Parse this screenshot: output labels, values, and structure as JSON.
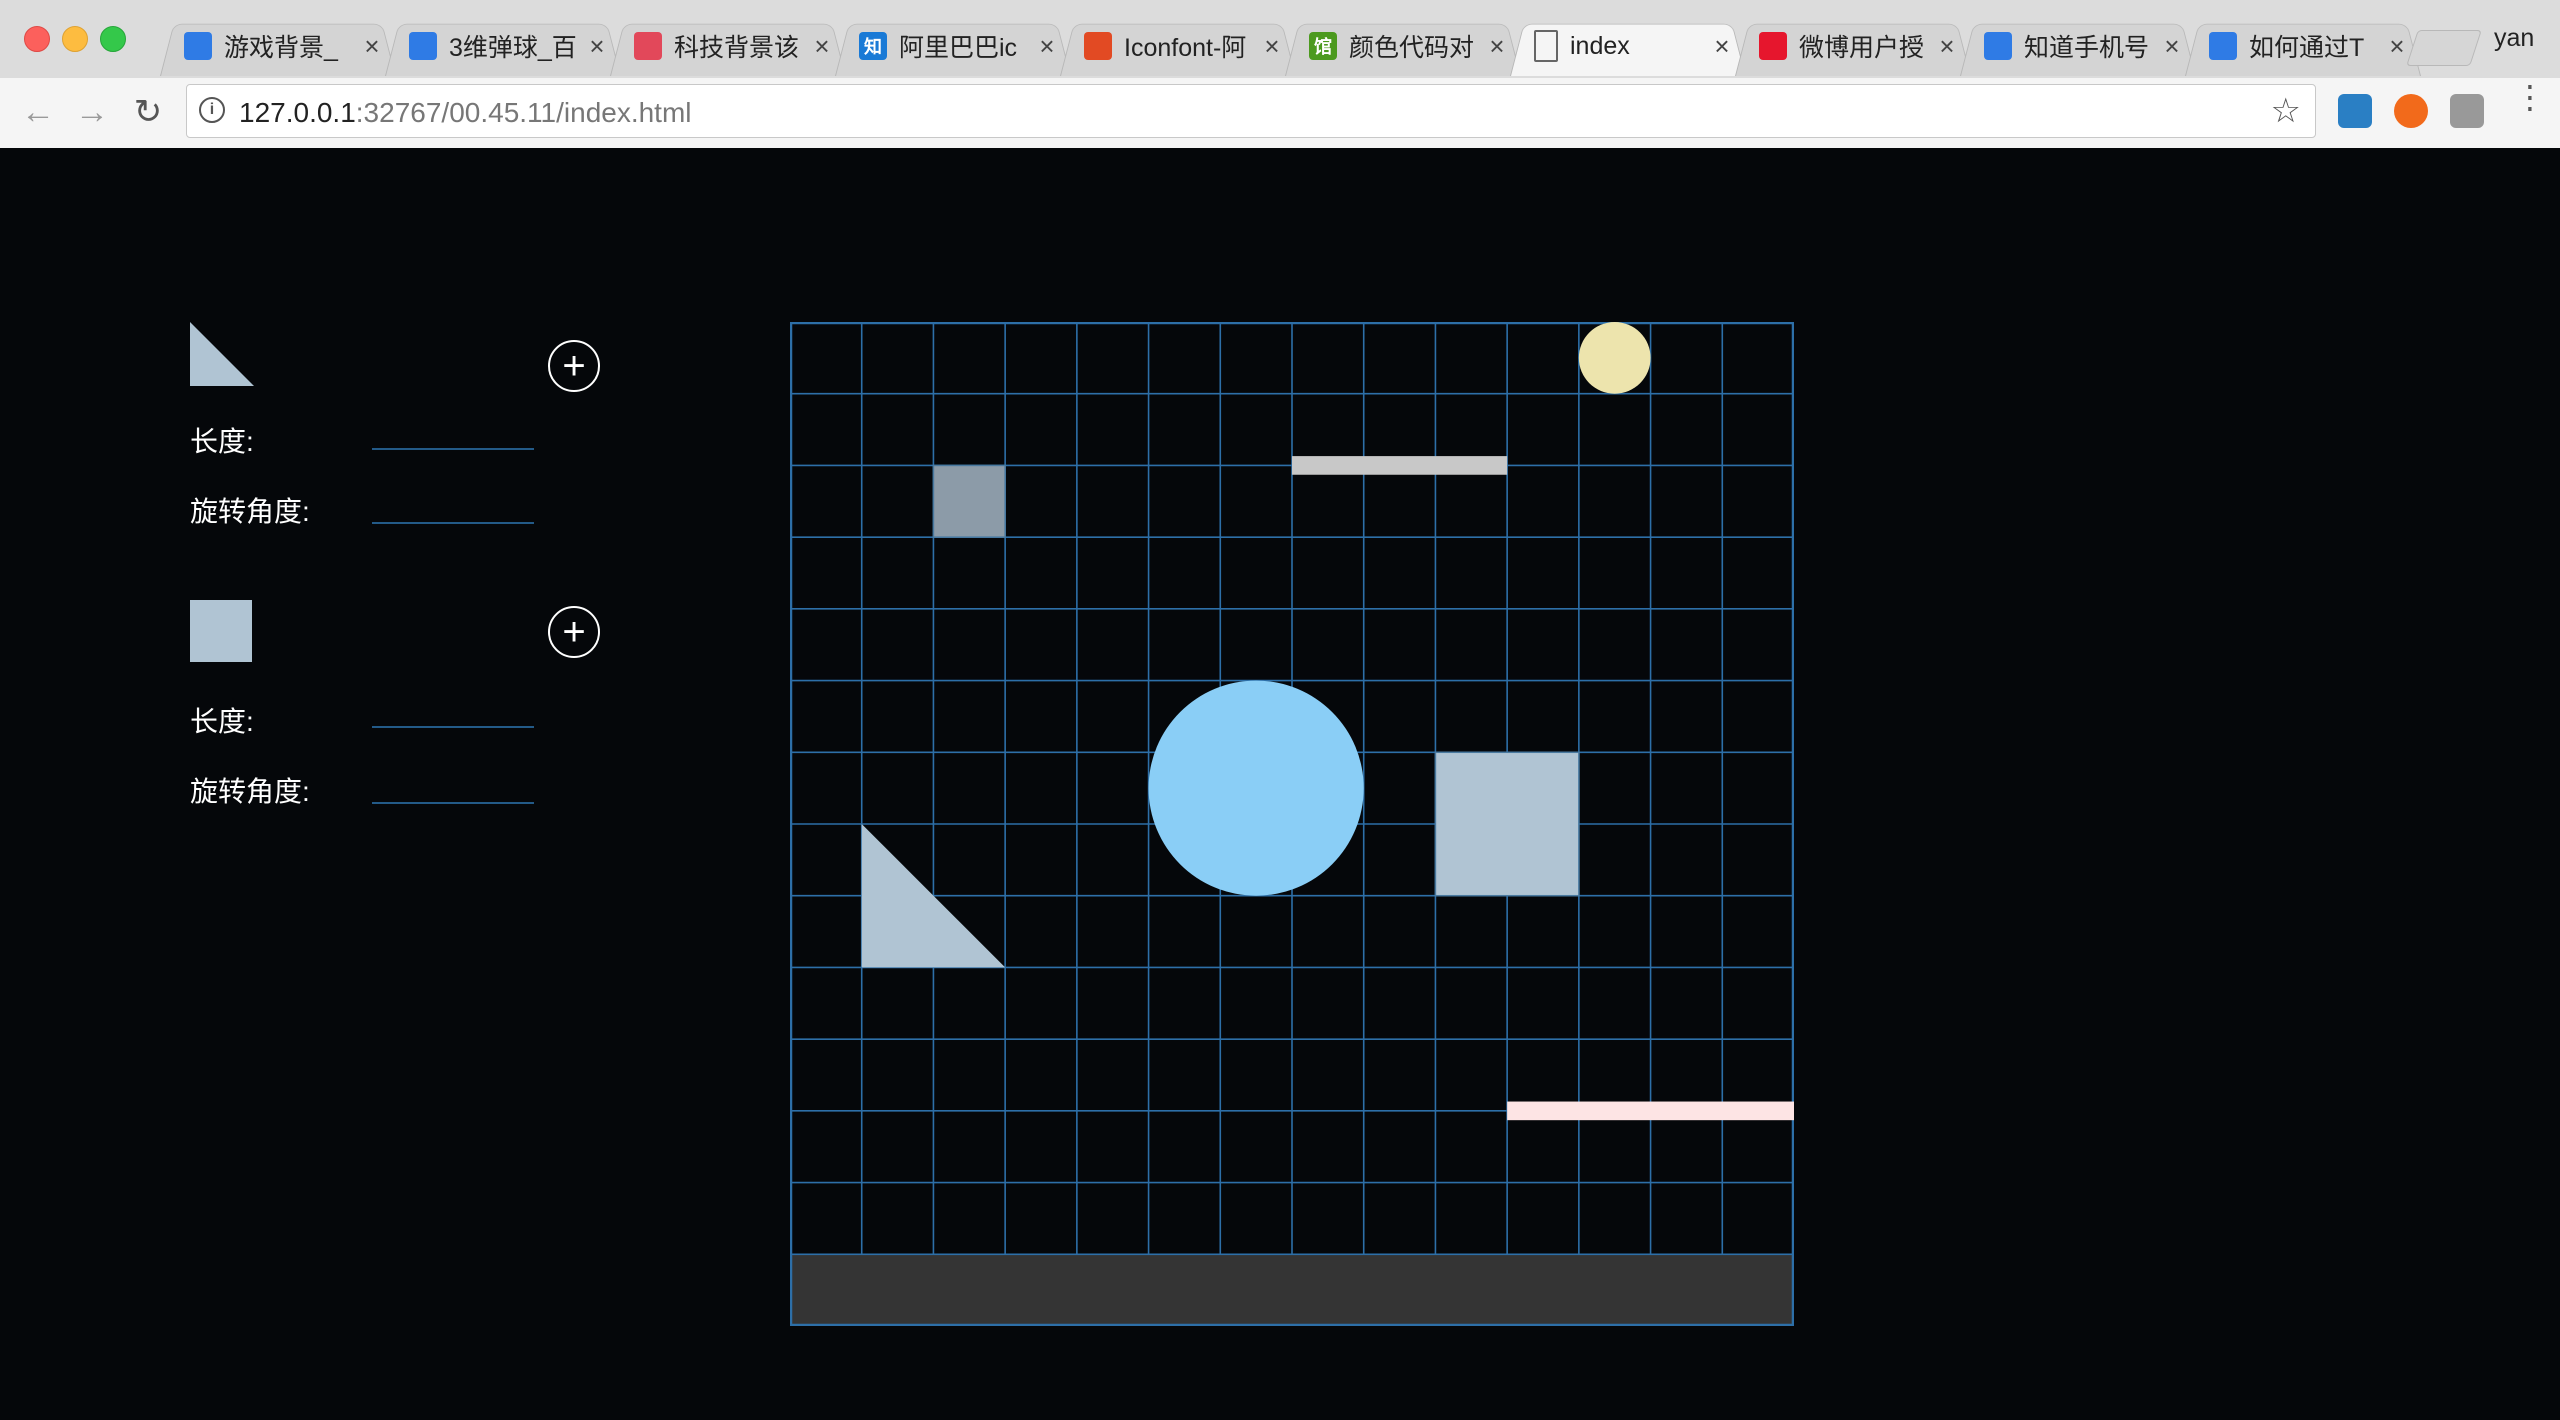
{
  "browser": {
    "tabs": [
      {
        "title": "游戏背景_",
        "favicon": "paw-icon",
        "color": "#2f7be5"
      },
      {
        "title": "3维弹球_百",
        "favicon": "paw-icon",
        "color": "#2f7be5"
      },
      {
        "title": "科技背景该",
        "favicon": "blob-icon",
        "color": "#e2485a"
      },
      {
        "title": "阿里巴巴ic",
        "favicon": "zhi-icon",
        "color": "#1a7ad6",
        "glyph": "知"
      },
      {
        "title": "Iconfont-阿",
        "favicon": "iconfont-icon",
        "color": "#e24a23"
      },
      {
        "title": "颜色代码对",
        "favicon": "guan-icon",
        "color": "#4c9a1f",
        "glyph": "馆"
      },
      {
        "title": "index",
        "favicon": "page-icon",
        "color": "#ffffff",
        "active": true
      },
      {
        "title": "微博用户授",
        "favicon": "weibo-icon",
        "color": "#e6162d"
      },
      {
        "title": "知道手机号",
        "favicon": "paw-icon",
        "color": "#2f7be5"
      },
      {
        "title": "如何通过T",
        "favicon": "paw-icon",
        "color": "#2f7be5"
      }
    ],
    "profile": "yan",
    "url_host": "127.0.0.1",
    "url_rest": ":32767/00.45.11/index.html"
  },
  "panel": {
    "triangle": {
      "length_label": "长度:",
      "angle_label": "旋转角度:",
      "color": "#b0c4d3"
    },
    "square": {
      "length_label": "长度:",
      "angle_label": "旋转角度:",
      "color": "#b0c4d3"
    },
    "add_symbol": "+"
  },
  "stage": {
    "grid_color": "#2d6fa8",
    "cols": 14,
    "rows": 13,
    "footer_color": "#343434",
    "shapes": [
      {
        "name": "yellow-ball",
        "kind": "circle",
        "col": 11,
        "row": 0,
        "size": 1,
        "color": "#ede4ad"
      },
      {
        "name": "gray-bar",
        "kind": "bar",
        "col": 7,
        "row": 2,
        "span": 3,
        "color": "#c8c8c8"
      },
      {
        "name": "small-square",
        "kind": "square",
        "col": 2,
        "row": 2,
        "size": 1,
        "color": "#8c9ba8"
      },
      {
        "name": "blue-circle",
        "kind": "circle",
        "col": 5,
        "row": 5,
        "size": 3,
        "color": "#8acef6"
      },
      {
        "name": "large-square",
        "kind": "square",
        "col": 9,
        "row": 6,
        "size": 2,
        "color": "#b0c4d3"
      },
      {
        "name": "triangle-shape",
        "kind": "triangle",
        "col": 1,
        "row": 7,
        "size": 2,
        "color": "#b0c4d3"
      },
      {
        "name": "pink-bar",
        "kind": "bar",
        "col": 10,
        "row": 11,
        "span": 4,
        "color": "#fde4e4"
      }
    ]
  }
}
